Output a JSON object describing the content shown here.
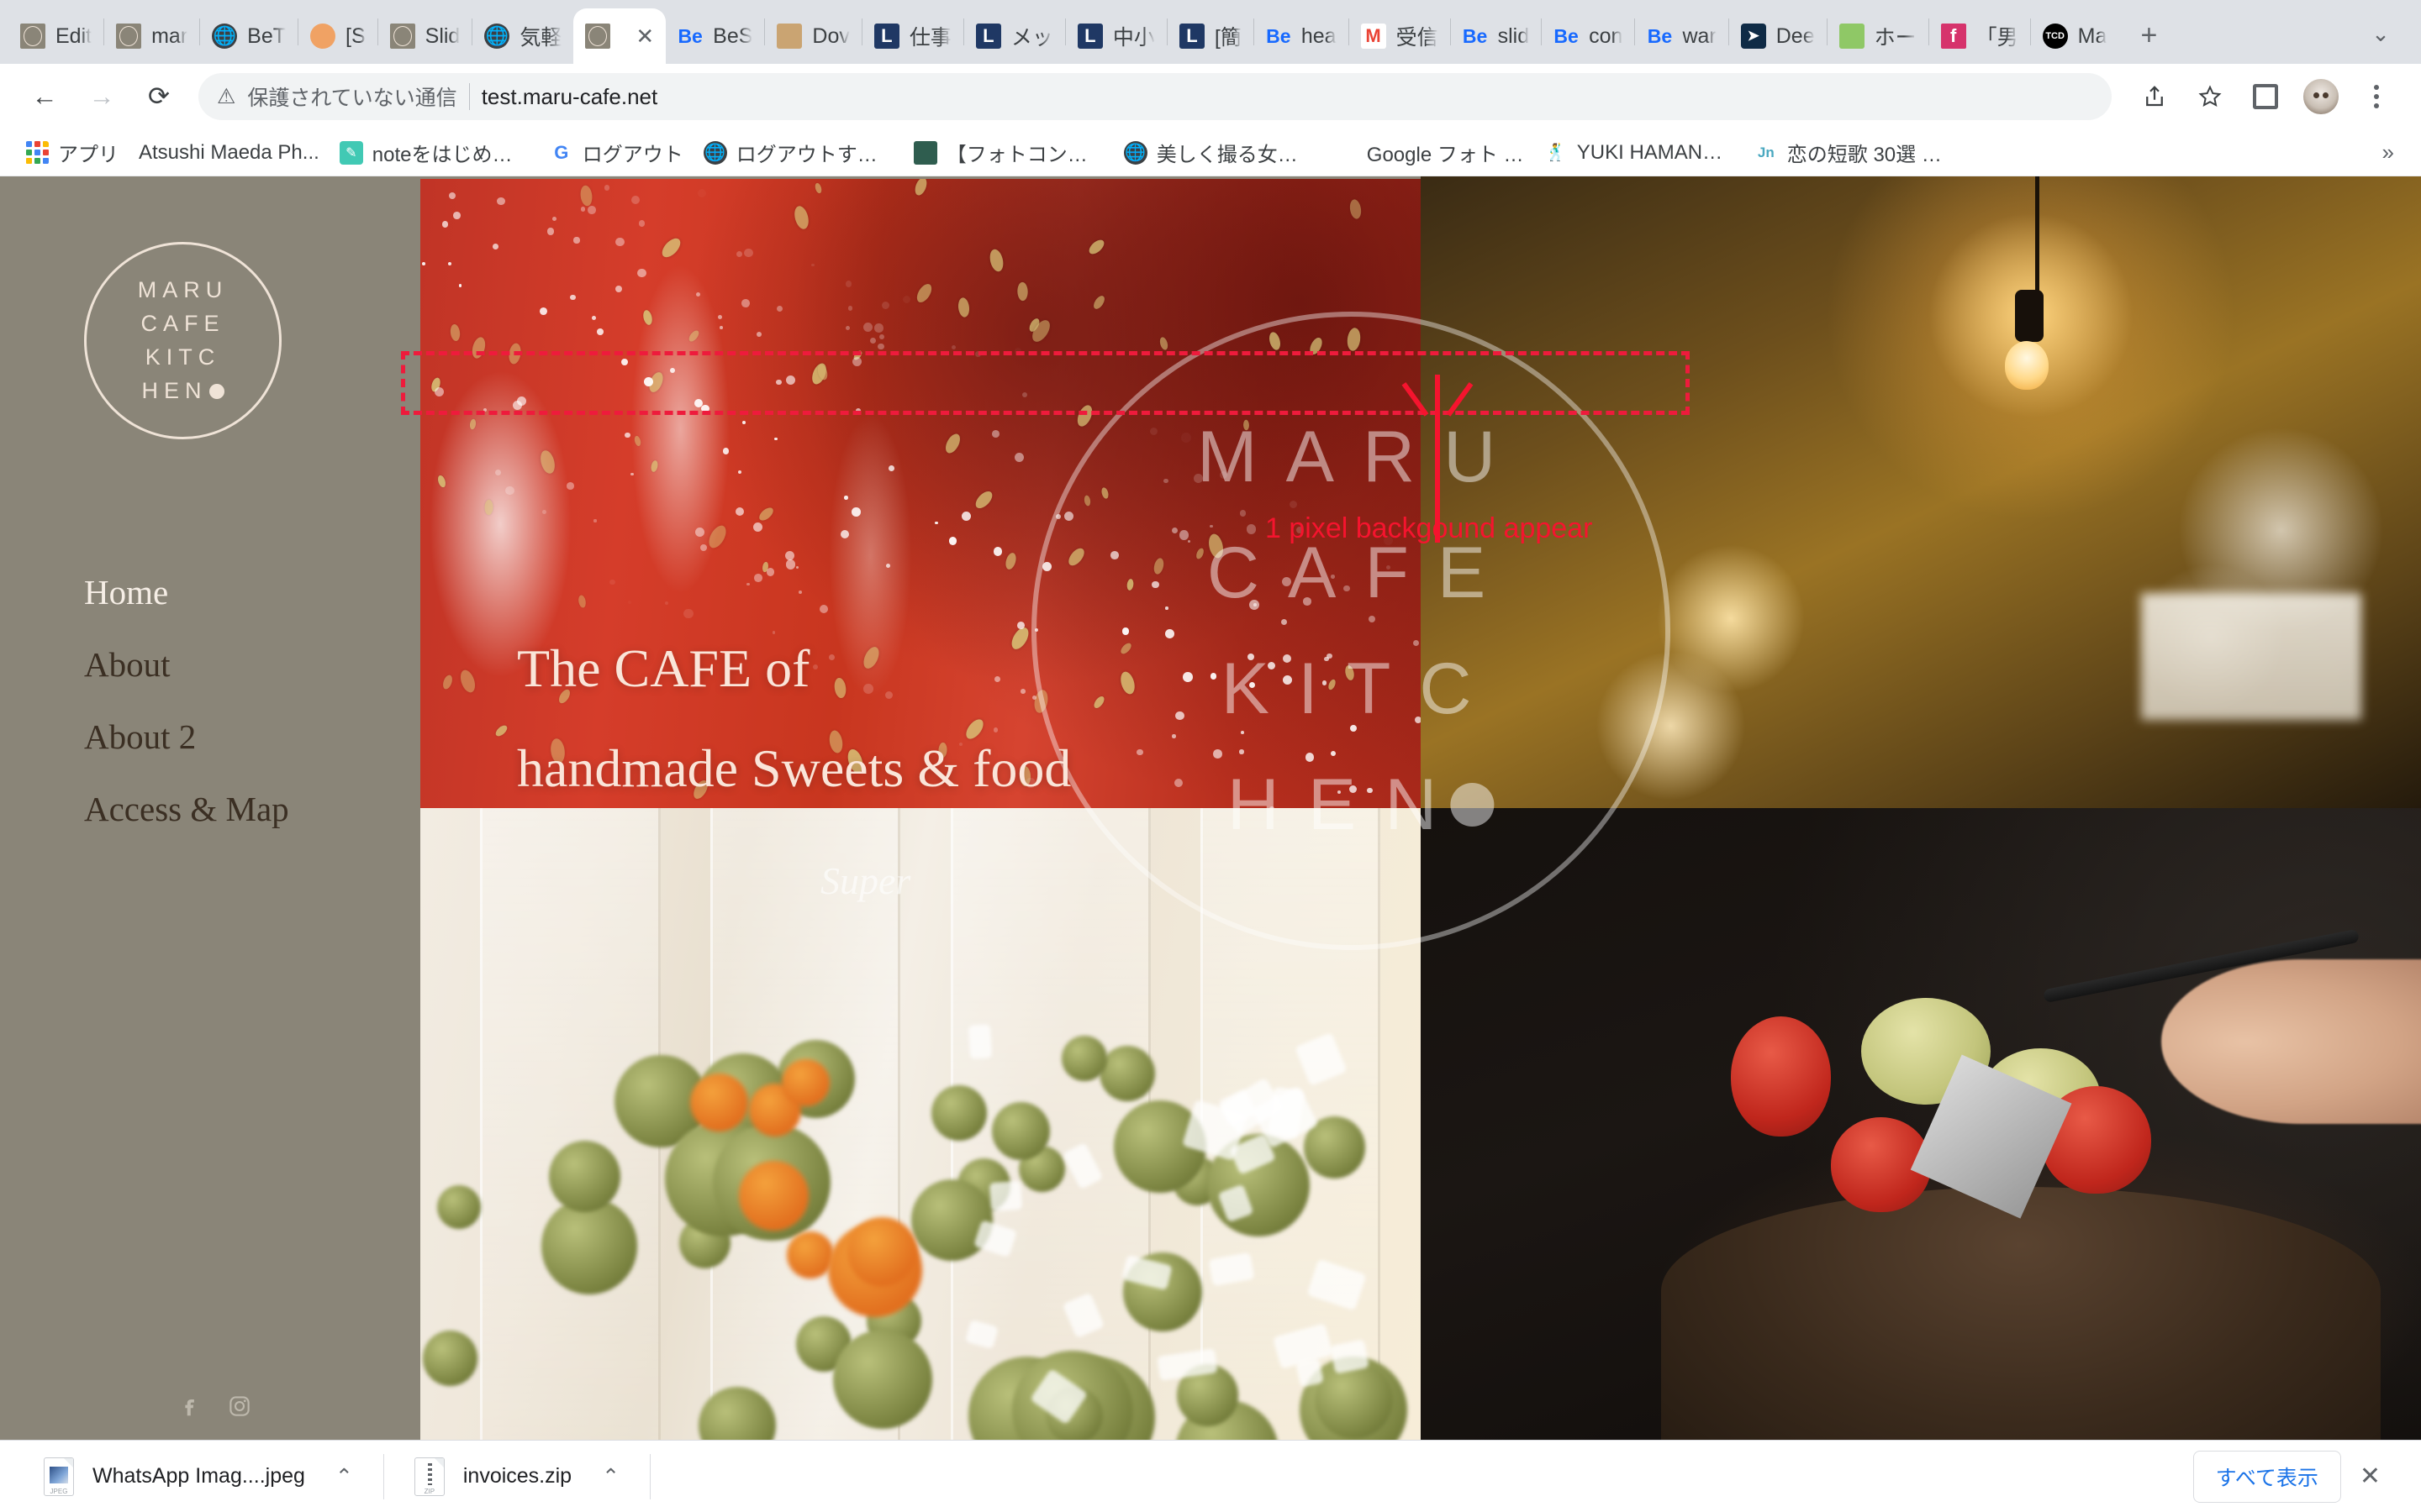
{
  "browser": {
    "tabs": [
      {
        "title": "Edit",
        "icon": "maru-logo-icon",
        "active": false
      },
      {
        "title": "mar",
        "icon": "maru-logo-icon",
        "active": false
      },
      {
        "title": "BeT",
        "icon": "globe-icon",
        "active": false
      },
      {
        "title": "[S",
        "icon": "peach-icon",
        "active": false
      },
      {
        "title": "Slid",
        "icon": "maru-logo-icon",
        "active": false
      },
      {
        "title": "気軽",
        "icon": "globe-icon",
        "active": false
      },
      {
        "title": "",
        "icon": "maru-logo-icon",
        "active": true
      },
      {
        "title": "BeS",
        "icon": "behance-icon",
        "active": false
      },
      {
        "title": "Dov",
        "icon": "document-thumb-icon",
        "active": false
      },
      {
        "title": "仕事",
        "icon": "line-icon",
        "active": false
      },
      {
        "title": "メッ",
        "icon": "line-icon",
        "active": false
      },
      {
        "title": "中小",
        "icon": "line-icon",
        "active": false
      },
      {
        "title": "[簡",
        "icon": "line-icon",
        "active": false
      },
      {
        "title": "hea",
        "icon": "behance-icon",
        "active": false
      },
      {
        "title": "受信",
        "icon": "gmail-icon",
        "active": false
      },
      {
        "title": "slid",
        "icon": "behance-icon",
        "active": false
      },
      {
        "title": "con",
        "icon": "behance-icon",
        "active": false
      },
      {
        "title": "war",
        "icon": "behance-icon",
        "active": false
      },
      {
        "title": "Dee",
        "icon": "deepl-icon",
        "active": false
      },
      {
        "title": "ホー",
        "icon": "green-mascot-icon",
        "active": false
      },
      {
        "title": "「男",
        "icon": "pink-f-icon",
        "active": false
      },
      {
        "title": "Ma",
        "icon": "tcd-icon",
        "active": false
      }
    ],
    "new_tab_label": "+",
    "tab_list_chevron": "⌄",
    "tab_close_label": "✕",
    "toolbar": {
      "back_label": "←",
      "forward_label": "→",
      "reload_label": "⟳",
      "security_warning_icon": "warning-triangle-icon",
      "security_text": "保護されていない通信",
      "url": "test.maru-cafe.net",
      "share_label": "share-icon",
      "bookmark_label": "star-icon",
      "sidepanel_label": "side-panel-icon",
      "profile_label": "avatar",
      "menu_label": "kebab-menu-icon"
    },
    "bookmarks": [
      {
        "label": "アプリ",
        "icon": "apps-grid-icon"
      },
      {
        "label": "Atsushi Maeda Ph...",
        "icon": "none"
      },
      {
        "label": "noteをはじめました...",
        "icon": "note-icon"
      },
      {
        "label": "ログアウト",
        "icon": "google-icon"
      },
      {
        "label": "ログアウトする（ト...",
        "icon": "globe-icon"
      },
      {
        "label": "【フォトコンテスト...",
        "icon": "book-icon"
      },
      {
        "label": "美しく撮る女性ポー...",
        "icon": "globe-icon"
      },
      {
        "label": "Google フォト - 思...",
        "icon": "google-photos-icon"
      },
      {
        "label": "YUKI HAMANAKA...",
        "icon": "dancer-icon"
      },
      {
        "label": "恋の短歌 30選 【...",
        "icon": "jin-icon"
      }
    ],
    "bookmarks_overflow_label": "»"
  },
  "page": {
    "brand": {
      "logo_lines": [
        "MARU",
        "CAFE",
        "KITC",
        "HEN"
      ],
      "logo_has_dot": true
    },
    "nav": [
      {
        "label": "Home",
        "active": true
      },
      {
        "label": "About",
        "active": false
      },
      {
        "label": "About 2",
        "active": false
      },
      {
        "label": "Access & Map",
        "active": false
      }
    ],
    "hero": {
      "line1": "The CAFE of",
      "line2": "handmade Sweets & food"
    },
    "watermark": {
      "lines": [
        "MARU",
        "CAFE",
        "KITC",
        "HEN"
      ]
    },
    "socials": [
      {
        "name": "facebook-icon"
      },
      {
        "name": "instagram-icon"
      }
    ],
    "annotation": {
      "label": "1 pixel backgound appear",
      "color": "#f5142e"
    }
  },
  "downloads": {
    "items": [
      {
        "name": "WhatsApp Imag....jpeg",
        "icon": "jpeg-file-icon",
        "caret": "⌃"
      },
      {
        "name": "invoices.zip",
        "icon": "zip-file-icon",
        "caret": "⌃"
      }
    ],
    "show_all_label": "すべて表示",
    "close_label": "✕"
  },
  "colors": {
    "page_background": "#8a8578",
    "brand_cream": "#efe3d7",
    "nav_dark": "#3b2f23",
    "annotation_red": "#f5142e",
    "link_blue": "#1a73e8"
  }
}
